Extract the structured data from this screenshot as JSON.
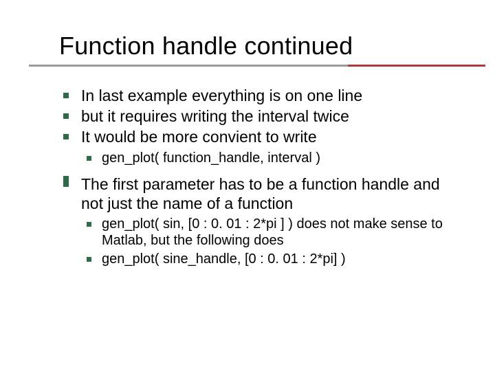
{
  "title": "Function handle continued",
  "bullets": {
    "b1": "In last example everything is on one line",
    "b2": "but it requires writing the interval twice",
    "b3": "It would be more convient to write",
    "b3_sub1": "gen_plot( function_handle, interval )",
    "b4": "The first parameter has to be a function handle and not just the name of a function",
    "b4_sub1": "gen_plot( sin, [0 : 0. 01 : 2*pi ] )   does not make sense to Matlab, but the following does",
    "b4_sub2": "gen_plot( sine_handle, [0 : 0. 01 : 2*pi] )"
  }
}
